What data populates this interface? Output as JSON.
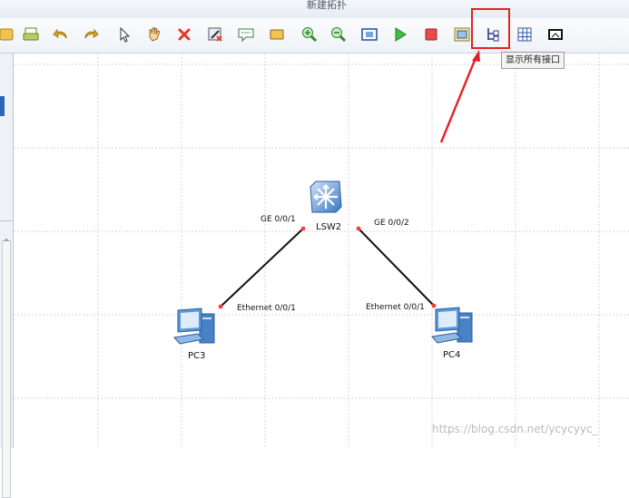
{
  "window": {
    "title": "新建拓扑"
  },
  "toolbar": {
    "buttons": [
      {
        "icon": "new-topology-icon"
      },
      {
        "icon": "print-icon"
      },
      {
        "icon": "undo-icon"
      },
      {
        "icon": "redo-icon"
      },
      {
        "icon": "select-pointer-icon"
      },
      {
        "icon": "hand-pan-icon"
      },
      {
        "icon": "delete-icon"
      },
      {
        "icon": "delete-link-icon"
      },
      {
        "icon": "text-note-icon"
      },
      {
        "icon": "rectangle-icon"
      },
      {
        "icon": "zoom-in-icon"
      },
      {
        "icon": "zoom-out-icon"
      },
      {
        "icon": "fit-window-icon"
      },
      {
        "icon": "start-device-icon"
      },
      {
        "icon": "stop-device-icon"
      },
      {
        "icon": "capture-icon"
      },
      {
        "icon": "show-interfaces-icon"
      },
      {
        "icon": "grid-icon"
      },
      {
        "icon": "topology-image-icon"
      }
    ],
    "tooltip": "显示所有接口",
    "accent_color": "#e52222"
  },
  "topology": {
    "devices": [
      {
        "name": "LSW2",
        "type": "switch"
      },
      {
        "name": "PC3",
        "type": "pc"
      },
      {
        "name": "PC4",
        "type": "pc"
      }
    ],
    "interface_labels": {
      "lsw2_left": "GE 0/0/1",
      "lsw2_right": "GE 0/0/2",
      "pc3": "Ethernet 0/0/1",
      "pc4": "Ethernet 0/0/1"
    }
  },
  "watermark": "https://blog.csdn.net/ycycyyc_"
}
